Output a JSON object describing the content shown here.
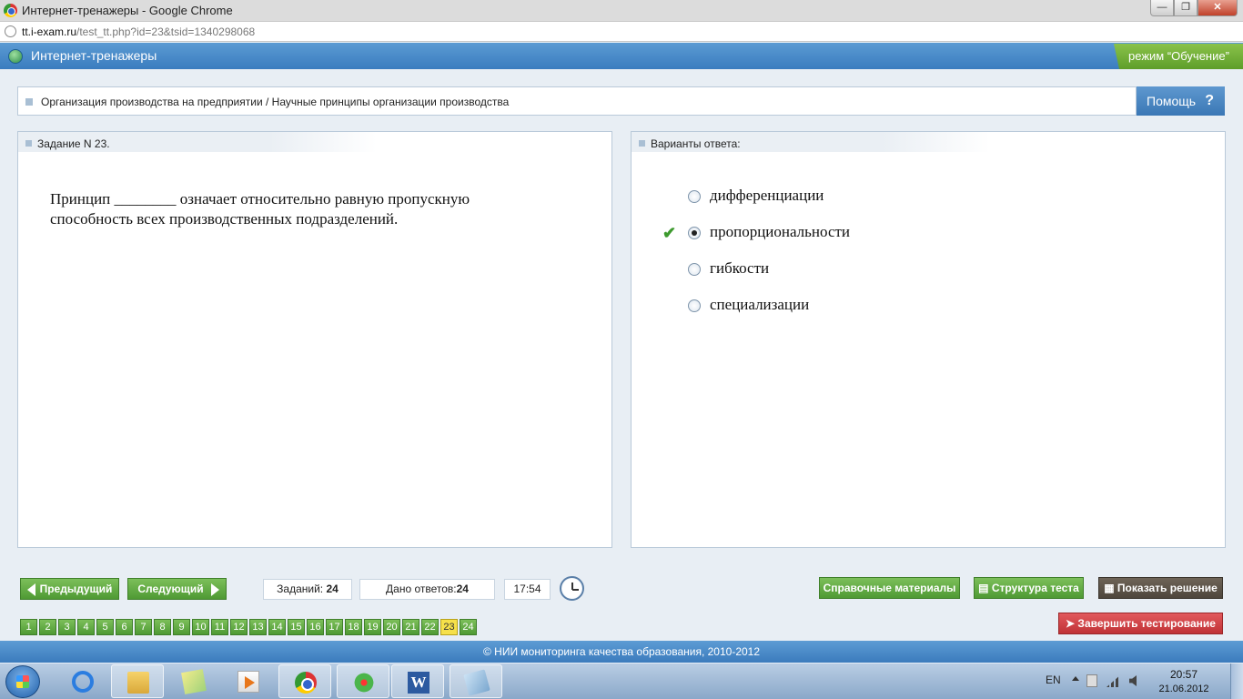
{
  "window": {
    "title": "Интернет-тренажеры - Google Chrome",
    "url_host": "tt.i-exam.ru",
    "url_path": "/test_tt.php?id=23&tsid=1340298068"
  },
  "app": {
    "title": "Интернет-тренажеры",
    "mode": "режим “Обучение”"
  },
  "breadcrumb": {
    "text": "Организация производства на предприятии / Научные принципы организации производства"
  },
  "help": {
    "label": "Помощь",
    "icon": "?"
  },
  "task": {
    "title": "Задание N 23.",
    "question": "Принцип ________ означает относительно равную пропускную способность всех производственных подразделений."
  },
  "answers": {
    "title": "Варианты ответа:",
    "options": [
      {
        "label": "дифференциации",
        "selected": false,
        "correct": false
      },
      {
        "label": "пропорциональности",
        "selected": true,
        "correct": true
      },
      {
        "label": "гибкости",
        "selected": false,
        "correct": false
      },
      {
        "label": "специализации",
        "selected": false,
        "correct": false
      }
    ]
  },
  "toolbar": {
    "prev": "Предыдущий",
    "next": "Следующий",
    "tasks_label": "Заданий:",
    "tasks_count": "24",
    "answers_label": "Дано ответов:",
    "answers_count": "24",
    "timer": "17:54",
    "reference": "Справочные материалы",
    "structure": "Структура теста",
    "solution": "Показать решение",
    "finish": "Завершить тестирование"
  },
  "pages": [
    "1",
    "2",
    "3",
    "4",
    "5",
    "6",
    "7",
    "8",
    "9",
    "10",
    "11",
    "12",
    "13",
    "14",
    "15",
    "16",
    "17",
    "18",
    "19",
    "20",
    "21",
    "22",
    "23",
    "24"
  ],
  "current_page": "23",
  "footer": "© НИИ мониторинга качества образования, 2010-2012",
  "taskbar": {
    "lang": "EN",
    "time": "20:57",
    "date": "21.06.2012"
  },
  "colors": {
    "header_blue": "#3a7cbf",
    "button_green": "#4f9a34",
    "current_page_yellow": "#f6e04a",
    "finish_red": "#c03236"
  }
}
